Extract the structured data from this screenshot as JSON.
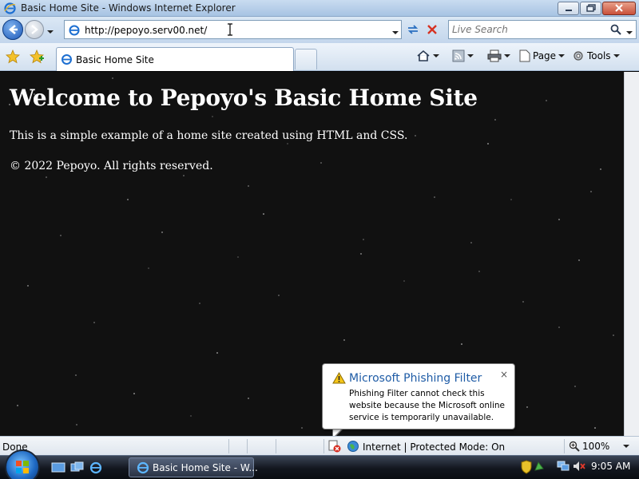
{
  "window": {
    "title": "Basic Home Site - Windows Internet Explorer",
    "minimize_icon": "minimize-icon",
    "maximize_icon": "maximize-icon",
    "close_icon": "close-icon"
  },
  "address_bar": {
    "url": "http://pepoyo.serv00.net/",
    "search_placeholder": "Live Search"
  },
  "tabs": [
    {
      "label": "Basic Home Site",
      "active": true
    }
  ],
  "command_bar": {
    "page_label": "Page",
    "tools_label": "Tools"
  },
  "page": {
    "heading": "Welcome to Pepoyo's Basic Home Site",
    "intro": "This is a simple example of a home site created using HTML and CSS.",
    "footer": "© 2022 Pepoyo. All rights reserved."
  },
  "notification": {
    "title": "Microsoft Phishing Filter",
    "message": "Phishing Filter cannot check this website because the Microsoft online service is temporarily unavailable.",
    "close_label": "×"
  },
  "status_bar": {
    "status": "Done",
    "zone": "Internet | Protected Mode: On",
    "zoom": "100%"
  },
  "taskbar": {
    "task_label": "Basic Home Site - W...",
    "clock": "9:05 AM"
  },
  "colors": {
    "page_background": "#111111",
    "notification_title": "#1f5ca6",
    "link_blue": "#1b58b8"
  }
}
